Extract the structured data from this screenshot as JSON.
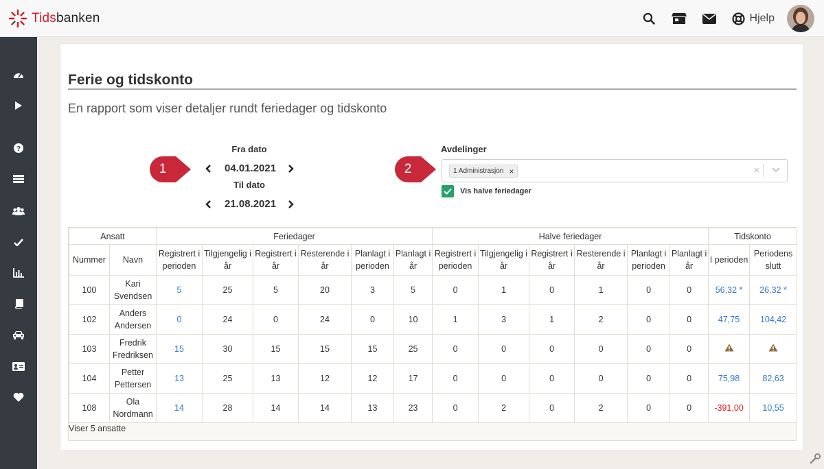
{
  "app": {
    "logo_plain": "Tids",
    "logo_bold": "banken"
  },
  "topbar": {
    "help_label": "Hjelp"
  },
  "page": {
    "title": "Ferie og tidskonto",
    "subtitle": "En rapport som viser detaljer rundt feriedager og tidskonto"
  },
  "dates": {
    "from_label": "Fra dato",
    "from_value": "04.01.2021",
    "to_label": "Til dato",
    "to_value": "21.08.2021"
  },
  "callouts": {
    "one": "1",
    "two": "2"
  },
  "departments": {
    "label": "Avdelinger",
    "selected_tag": "1 Administrasjon",
    "tag_remove": "×",
    "clear": "×"
  },
  "half_days": {
    "label": "Vis halve feriedager",
    "checked": true
  },
  "table": {
    "groups": [
      "Ansatt",
      "Feriedager",
      "Halve feriedager",
      "Tidskonto"
    ],
    "columns": [
      "Nummer",
      "Navn",
      "Registrert i perioden",
      "Tilgjengelig i år",
      "Registrert i år",
      "Resterende i år",
      "Planlagt i perioden",
      "Planlagt i år",
      "Registrert i perioden",
      "Tilgjengelig i år",
      "Registrert i år",
      "Resterende i år",
      "Planlagt i perioden",
      "Planlagt i år",
      "I perioden",
      "Periodens slutt"
    ],
    "rows": [
      {
        "nummer": "100",
        "navn": "Kari Svendsen",
        "f_reg_periode": "5",
        "f_tilgj": "25",
        "f_reg_aar": "5",
        "f_rest": "20",
        "f_plan_periode": "3",
        "f_plan_aar": "5",
        "h_reg_periode": "0",
        "h_tilgj": "1",
        "h_reg_aar": "0",
        "h_rest": "1",
        "h_plan_periode": "0",
        "h_plan_aar": "0",
        "t_periode": "56,32 *",
        "t_slutt": "26,32 *"
      },
      {
        "nummer": "102",
        "navn": "Anders Andersen",
        "f_reg_periode": "0",
        "f_tilgj": "24",
        "f_reg_aar": "0",
        "f_rest": "24",
        "f_plan_periode": "0",
        "f_plan_aar": "10",
        "h_reg_periode": "1",
        "h_tilgj": "3",
        "h_reg_aar": "1",
        "h_rest": "2",
        "h_plan_periode": "0",
        "h_plan_aar": "0",
        "t_periode": "47,75",
        "t_slutt": "104,42"
      },
      {
        "nummer": "103",
        "navn": "Fredrik Fredriksen",
        "f_reg_periode": "15",
        "f_tilgj": "30",
        "f_reg_aar": "15",
        "f_rest": "15",
        "f_plan_periode": "15",
        "f_plan_aar": "25",
        "h_reg_periode": "0",
        "h_tilgj": "0",
        "h_reg_aar": "0",
        "h_rest": "0",
        "h_plan_periode": "0",
        "h_plan_aar": "0",
        "t_periode_icon": "warning-icon",
        "t_slutt_icon": "warning-icon"
      },
      {
        "nummer": "104",
        "navn": "Petter Pettersen",
        "f_reg_periode": "13",
        "f_tilgj": "25",
        "f_reg_aar": "13",
        "f_rest": "12",
        "f_plan_periode": "12",
        "f_plan_aar": "17",
        "h_reg_periode": "0",
        "h_tilgj": "0",
        "h_reg_aar": "0",
        "h_rest": "0",
        "h_plan_periode": "0",
        "h_plan_aar": "0",
        "t_periode": "75,98",
        "t_slutt": "82,63"
      },
      {
        "nummer": "108",
        "navn": "Ola Nordmann",
        "f_reg_periode": "14",
        "f_tilgj": "28",
        "f_reg_aar": "14",
        "f_rest": "14",
        "f_plan_periode": "13",
        "f_plan_aar": "23",
        "h_reg_periode": "0",
        "h_tilgj": "2",
        "h_reg_aar": "0",
        "h_rest": "2",
        "h_plan_periode": "0",
        "h_plan_aar": "0",
        "t_periode": "-391,00",
        "t_slutt": "10,55"
      }
    ],
    "footer": "Viser 5 ansatte"
  },
  "colors": {
    "brand_red": "#d81b28",
    "callout_red": "#c8283a",
    "link_blue": "#3377cc",
    "negative_red": "#e02020",
    "check_green": "#28a06a",
    "warning": "#8a6d3b",
    "sidebar": "#353b40"
  },
  "icons": {
    "topbar": [
      "search-icon",
      "store-icon",
      "envelope-icon",
      "lifebuoy-icon"
    ],
    "sidebar": [
      "dashboard-icon",
      "play-icon",
      "question-icon",
      "list-icon",
      "users-icon",
      "check-icon",
      "bar-chart-icon",
      "book-icon",
      "car-icon",
      "id-card-icon",
      "heart-icon"
    ]
  }
}
